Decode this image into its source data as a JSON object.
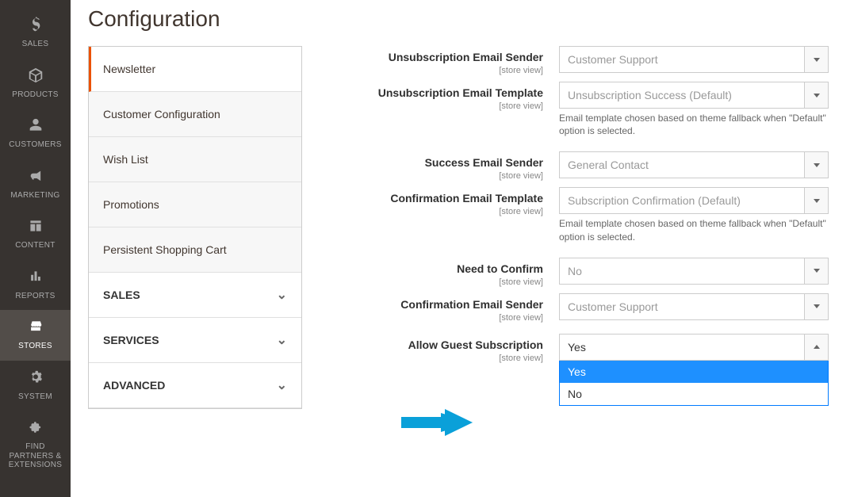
{
  "sidebar": {
    "items": [
      {
        "label": "SALES"
      },
      {
        "label": "PRODUCTS"
      },
      {
        "label": "CUSTOMERS"
      },
      {
        "label": "MARKETING"
      },
      {
        "label": "CONTENT"
      },
      {
        "label": "REPORTS"
      },
      {
        "label": "STORES"
      },
      {
        "label": "SYSTEM"
      },
      {
        "label": "FIND PARTNERS & EXTENSIONS"
      }
    ]
  },
  "page": {
    "title": "Configuration"
  },
  "tabs": {
    "items": [
      {
        "label": "Newsletter",
        "active": true
      },
      {
        "label": "Customer Configuration"
      },
      {
        "label": "Wish List"
      },
      {
        "label": "Promotions"
      },
      {
        "label": "Persistent Shopping Cart"
      }
    ],
    "groups": [
      {
        "label": "SALES"
      },
      {
        "label": "SERVICES"
      },
      {
        "label": "ADVANCED"
      }
    ]
  },
  "fields": {
    "scope_text": "[store view]",
    "unsub_sender": {
      "label": "Unsubscription Email Sender",
      "value": "Customer Support"
    },
    "unsub_template": {
      "label": "Unsubscription Email Template",
      "value": "Unsubscription Success (Default)",
      "note": "Email template chosen based on theme fallback when \"Default\" option is selected."
    },
    "success_sender": {
      "label": "Success Email Sender",
      "value": "General Contact"
    },
    "confirm_template": {
      "label": "Confirmation Email Template",
      "value": "Subscription Confirmation (Default)",
      "note": "Email template chosen based on theme fallback when \"Default\" option is selected."
    },
    "need_confirm": {
      "label": "Need to Confirm",
      "value": "No"
    },
    "confirm_sender": {
      "label": "Confirmation Email Sender",
      "value": "Customer Support"
    },
    "allow_guest": {
      "label": "Allow Guest Subscription",
      "value": "Yes",
      "options": [
        "Yes",
        "No"
      ]
    }
  }
}
